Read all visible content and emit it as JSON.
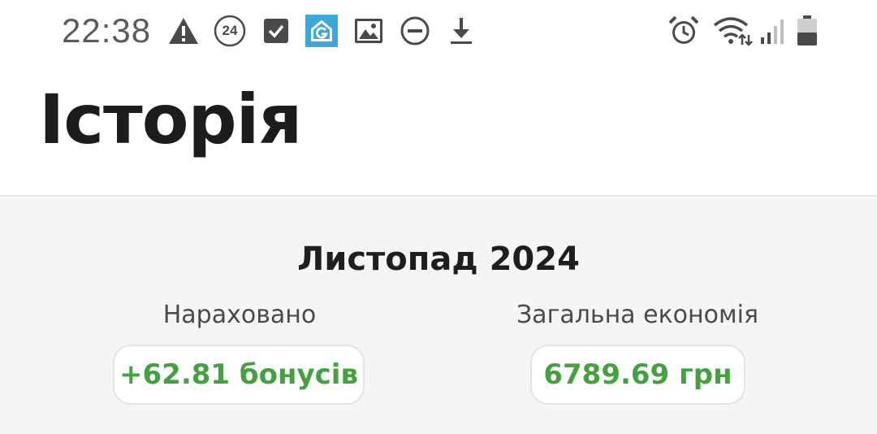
{
  "status_bar": {
    "time": "22:38",
    "notification_badge": "24",
    "icons": [
      "warning-icon",
      "notification-24-icon",
      "checkbox-icon",
      "app-g-icon",
      "image-icon",
      "dnd-icon",
      "download-icon",
      "alarm-icon",
      "wifi-icon",
      "signal-icon",
      "battery-icon"
    ]
  },
  "header": {
    "title": "Історія"
  },
  "summary": {
    "month": "Листопад 2024",
    "accrued": {
      "label": "Нараховано",
      "value": "+62.81 бонусів"
    },
    "savings": {
      "label": "Загальна економія",
      "value": "6789.69 грн"
    }
  },
  "colors": {
    "accent_green": "#43a23f",
    "content_bg": "#f4f6f5",
    "title_text": "#1c1c1c"
  }
}
